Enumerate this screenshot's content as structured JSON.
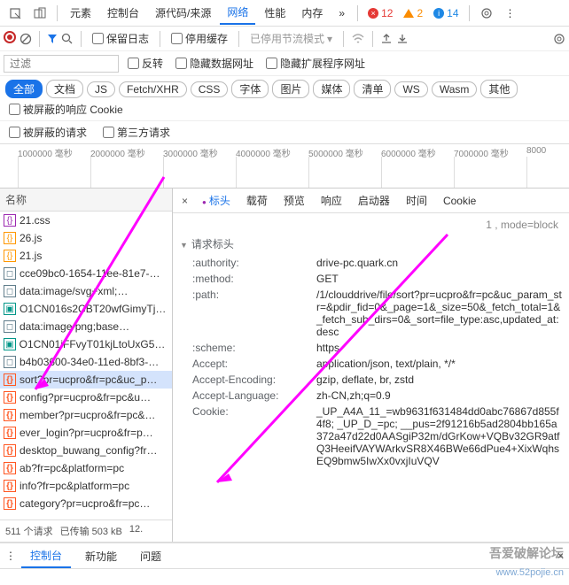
{
  "topTabs": [
    "元素",
    "控制台",
    "源代码/来源",
    "网络",
    "性能",
    "内存"
  ],
  "topTabActive": 3,
  "topBadges": {
    "errors": 12,
    "warnings": 2,
    "info": 14
  },
  "toolbar2": {
    "preserveLog": "保留日志",
    "disableCache": "停用缓存",
    "throttling": "已停用节流模式"
  },
  "filter": {
    "placeholder": "过滤",
    "invert": "反转",
    "hideData": "隐藏数据网址",
    "hideExt": "隐藏扩展程序网址"
  },
  "chips": [
    "全部",
    "文档",
    "JS",
    "Fetch/XHR",
    "CSS",
    "字体",
    "图片",
    "媒体",
    "清单",
    "WS",
    "Wasm",
    "其他"
  ],
  "chipActive": 0,
  "blockedCookies": "被屏蔽的响应 Cookie",
  "blockedReq": "被屏蔽的请求",
  "thirdParty": "第三方请求",
  "timeline": [
    "1000000 毫秒",
    "2000000 毫秒",
    "3000000 毫秒",
    "4000000 毫秒",
    "5000000 毫秒",
    "6000000 毫秒",
    "7000000 毫秒",
    "8000"
  ],
  "left": {
    "header": "名称",
    "items": [
      {
        "ico": "css",
        "t": "21.css"
      },
      {
        "ico": "js",
        "t": "26.js"
      },
      {
        "ico": "js",
        "t": "21.js"
      },
      {
        "ico": "file",
        "t": "cce09bc0-1654-11ee-81e7-…"
      },
      {
        "ico": "file",
        "t": "data:image/svg+xml;…"
      },
      {
        "ico": "img",
        "t": "O1CN016s2CBT20wfGimyTj…"
      },
      {
        "ico": "file",
        "t": "data:image/png;base…"
      },
      {
        "ico": "img",
        "t": "O1CN01iFFvyT01kjLtoUxG5C…"
      },
      {
        "ico": "file",
        "t": "b4b03600-34e0-11ed-8bf3-…"
      },
      {
        "ico": "x",
        "t": "sort?pr=ucpro&fr=pc&uc_p…",
        "sel": true
      },
      {
        "ico": "x",
        "t": "config?pr=ucpro&fr=pc&u…"
      },
      {
        "ico": "x",
        "t": "member?pr=ucpro&fr=pc&…"
      },
      {
        "ico": "x",
        "t": "ever_login?pr=ucpro&fr=p…"
      },
      {
        "ico": "x",
        "t": "desktop_buwang_config?fr…"
      },
      {
        "ico": "x",
        "t": "ab?fr=pc&platform=pc"
      },
      {
        "ico": "x",
        "t": "info?fr=pc&platform=pc"
      },
      {
        "ico": "x",
        "t": "category?pr=ucpro&fr=pc…"
      }
    ],
    "footer": {
      "requests": "511 个请求",
      "transferred": "已传输 503 kB",
      "resources": "12."
    }
  },
  "right": {
    "tabs": [
      "标头",
      "载荷",
      "预览",
      "响应",
      "启动器",
      "时间",
      "Cookie"
    ],
    "tabActive": 0,
    "sectionTitle": "请求标头",
    "preLine": "1 , mode=block",
    "rows": [
      {
        "k": ":authority:",
        "v": "drive-pc.quark.cn"
      },
      {
        "k": ":method:",
        "v": "GET"
      },
      {
        "k": ":path:",
        "v": "/1/clouddrive/file/sort?pr=ucpro&fr=pc&uc_param_str=&pdir_fid=0&_page=1&_size=50&_fetch_total=1&_fetch_sub_dirs=0&_sort=file_type:asc,updated_at:desc"
      },
      {
        "k": ":scheme:",
        "v": "https"
      },
      {
        "k": "Accept:",
        "v": "application/json, text/plain, */*"
      },
      {
        "k": "Accept-Encoding:",
        "v": "gzip, deflate, br, zstd"
      },
      {
        "k": "Accept-Language:",
        "v": "zh-CN,zh;q=0.9"
      },
      {
        "k": "Cookie:",
        "v": "_UP_A4A_11_=wb9631f631484dd0abc76867d855f4f8; _UP_D_=pc; __pus=2f91216b5ad2804bb165a372a47d22d0AASgiP32m/dGrKow+VQBv32GR9atfQ3HeeifVAYWArkvSR8X46BWe66dPue4+XixWqhsEQ9bmw5IwXx0vxjIuVQV"
      }
    ]
  },
  "bottom": {
    "tabs": [
      "控制台",
      "新功能",
      "问题"
    ],
    "active": 0
  },
  "watermark1": "吾爱破解论坛",
  "watermark2": "www.52pojie.cn"
}
